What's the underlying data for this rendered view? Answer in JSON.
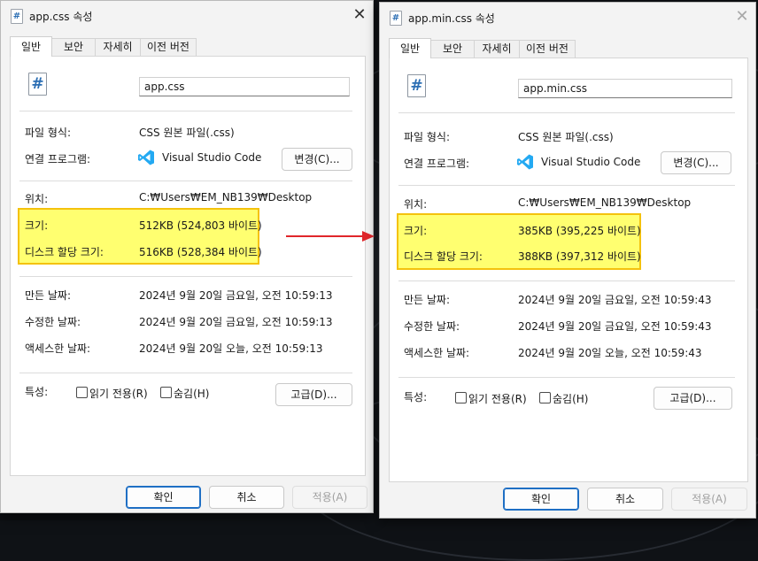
{
  "left_dialog": {
    "title": "app.css 속성",
    "close_label": "✕",
    "tabs": [
      "일반",
      "보안",
      "자세히",
      "이전 버전"
    ],
    "file_name": "app.css",
    "file_type_label": "파일 형식:",
    "file_type_value": "CSS 원본 파일(.css)",
    "open_with_label": "연결 프로그램:",
    "open_with_app": "Visual Studio Code",
    "change_button": "변경(C)...",
    "location_label": "위치:",
    "location_value": "C:₩Users₩EM_NB139₩Desktop",
    "size_label": "크기:",
    "size_value": "512KB (524,803 바이트)",
    "disk_size_label": "디스크 할당 크기:",
    "disk_size_value": "516KB (528,384 바이트)",
    "created_label": "만든 날짜:",
    "created_value": "2024년 9월 20일 금요일, 오전 10:59:13",
    "modified_label": "수정한 날짜:",
    "modified_value": "2024년 9월 20일 금요일, 오전 10:59:13",
    "accessed_label": "액세스한 날짜:",
    "accessed_value": "2024년 9월 20일 오늘, 오전 10:59:13",
    "attributes_label": "특성:",
    "readonly_label": "읽기 전용(R)",
    "hidden_label": "숨김(H)",
    "advanced_button": "고급(D)...",
    "ok_button": "확인",
    "cancel_button": "취소",
    "apply_button": "적용(A)"
  },
  "right_dialog": {
    "title": "app.min.css 속성",
    "close_label": "✕",
    "tabs": [
      "일반",
      "보안",
      "자세히",
      "이전 버전"
    ],
    "file_name": "app.min.css",
    "file_type_label": "파일 형식:",
    "file_type_value": "CSS 원본 파일(.css)",
    "open_with_label": "연결 프로그램:",
    "open_with_app": "Visual Studio Code",
    "change_button": "변경(C)...",
    "location_label": "위치:",
    "location_value": "C:₩Users₩EM_NB139₩Desktop",
    "size_label": "크기:",
    "size_value": "385KB (395,225 바이트)",
    "disk_size_label": "디스크 할당 크기:",
    "disk_size_value": "388KB (397,312 바이트)",
    "created_label": "만든 날짜:",
    "created_value": "2024년 9월 20일 금요일, 오전 10:59:43",
    "modified_label": "수정한 날짜:",
    "modified_value": "2024년 9월 20일 금요일, 오전 10:59:43",
    "accessed_label": "액세스한 날짜:",
    "accessed_value": "2024년 9월 20일 오늘, 오전 10:59:43",
    "attributes_label": "특성:",
    "readonly_label": "읽기 전용(R)",
    "hidden_label": "숨김(H)",
    "advanced_button": "고급(D)...",
    "ok_button": "확인",
    "cancel_button": "취소",
    "apply_button": "적용(A)"
  },
  "icons": {
    "file_glyph": "#",
    "file_icon": "css-file-icon",
    "app_icon": "vscode-icon",
    "arrow": "red-arrow-right"
  },
  "colors": {
    "highlight_fill": "#ffff70",
    "highlight_border": "#f4c20d",
    "arrow": "#e0262b",
    "accent": "#1f6fc4",
    "vscode_blue": "#23a9f2"
  }
}
